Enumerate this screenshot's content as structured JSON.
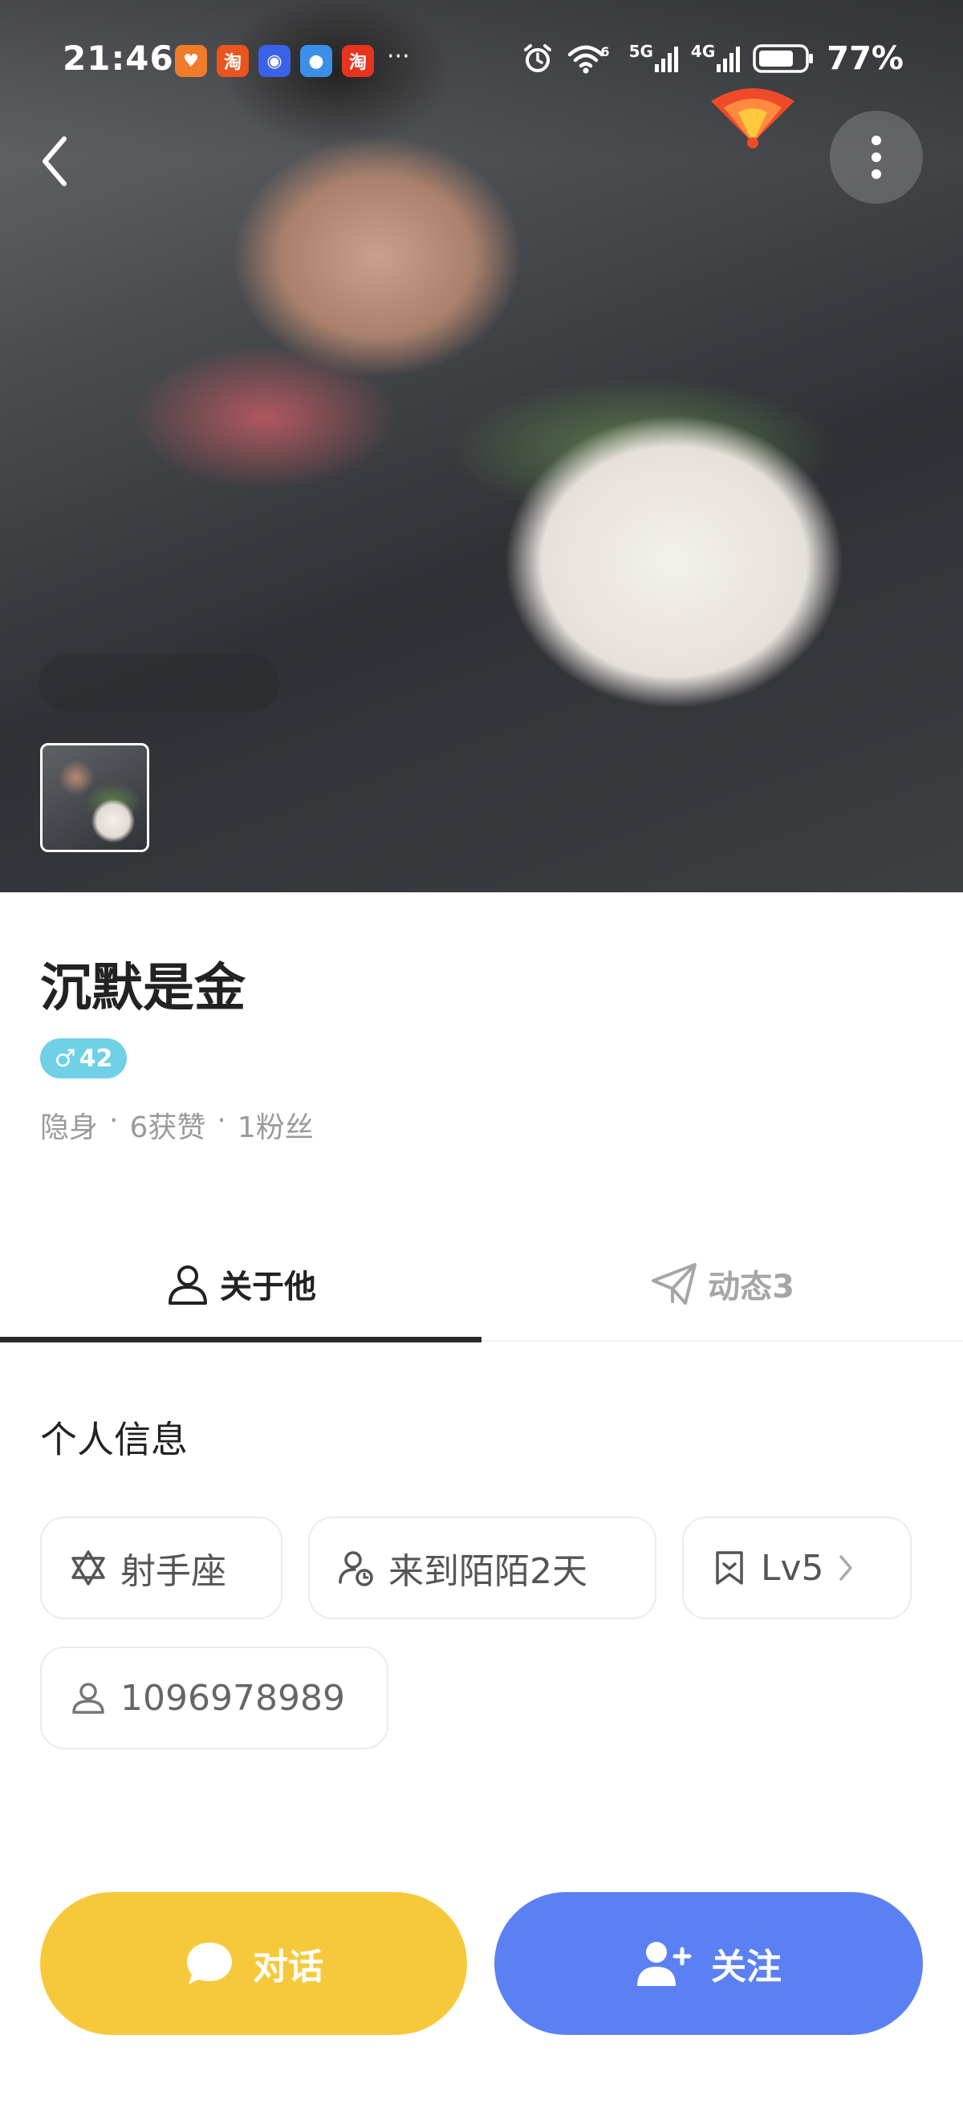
{
  "status_bar": {
    "time": "21:46",
    "battery_percent": "77%",
    "network_1": "5G",
    "network_2": "4G",
    "wifi_badge": "6",
    "more": "···",
    "app_icons": [
      "taobao-badge-icon",
      "taobao-sale-icon",
      "qq-icon",
      "browser-icon",
      "taobao-icon"
    ]
  },
  "header": {
    "back_icon": "chevron-left-icon",
    "more_icon": "more-vertical-icon",
    "promo_icon": "red-fan-icon"
  },
  "profile": {
    "name": "沉默是金",
    "gender_symbol": "♂",
    "age": "42",
    "online_status": "隐身",
    "likes": "6获赞",
    "fans": "1粉丝",
    "separator": "·"
  },
  "tabs": [
    {
      "label": "关于他",
      "icon": "person-icon",
      "active": true
    },
    {
      "label": "动态3",
      "icon": "send-icon",
      "active": false
    }
  ],
  "info": {
    "section_title": "个人信息",
    "zodiac": "射手座",
    "days_on_app": "来到陌陌2天",
    "level": "Lv5",
    "user_id": "1096978989"
  },
  "actions": {
    "chat_label": "对话",
    "follow_label": "关注"
  },
  "colors": {
    "chat_button": "#f6c93d",
    "follow_button": "#5b80f3",
    "gender_badge": "#6fd0e6"
  }
}
